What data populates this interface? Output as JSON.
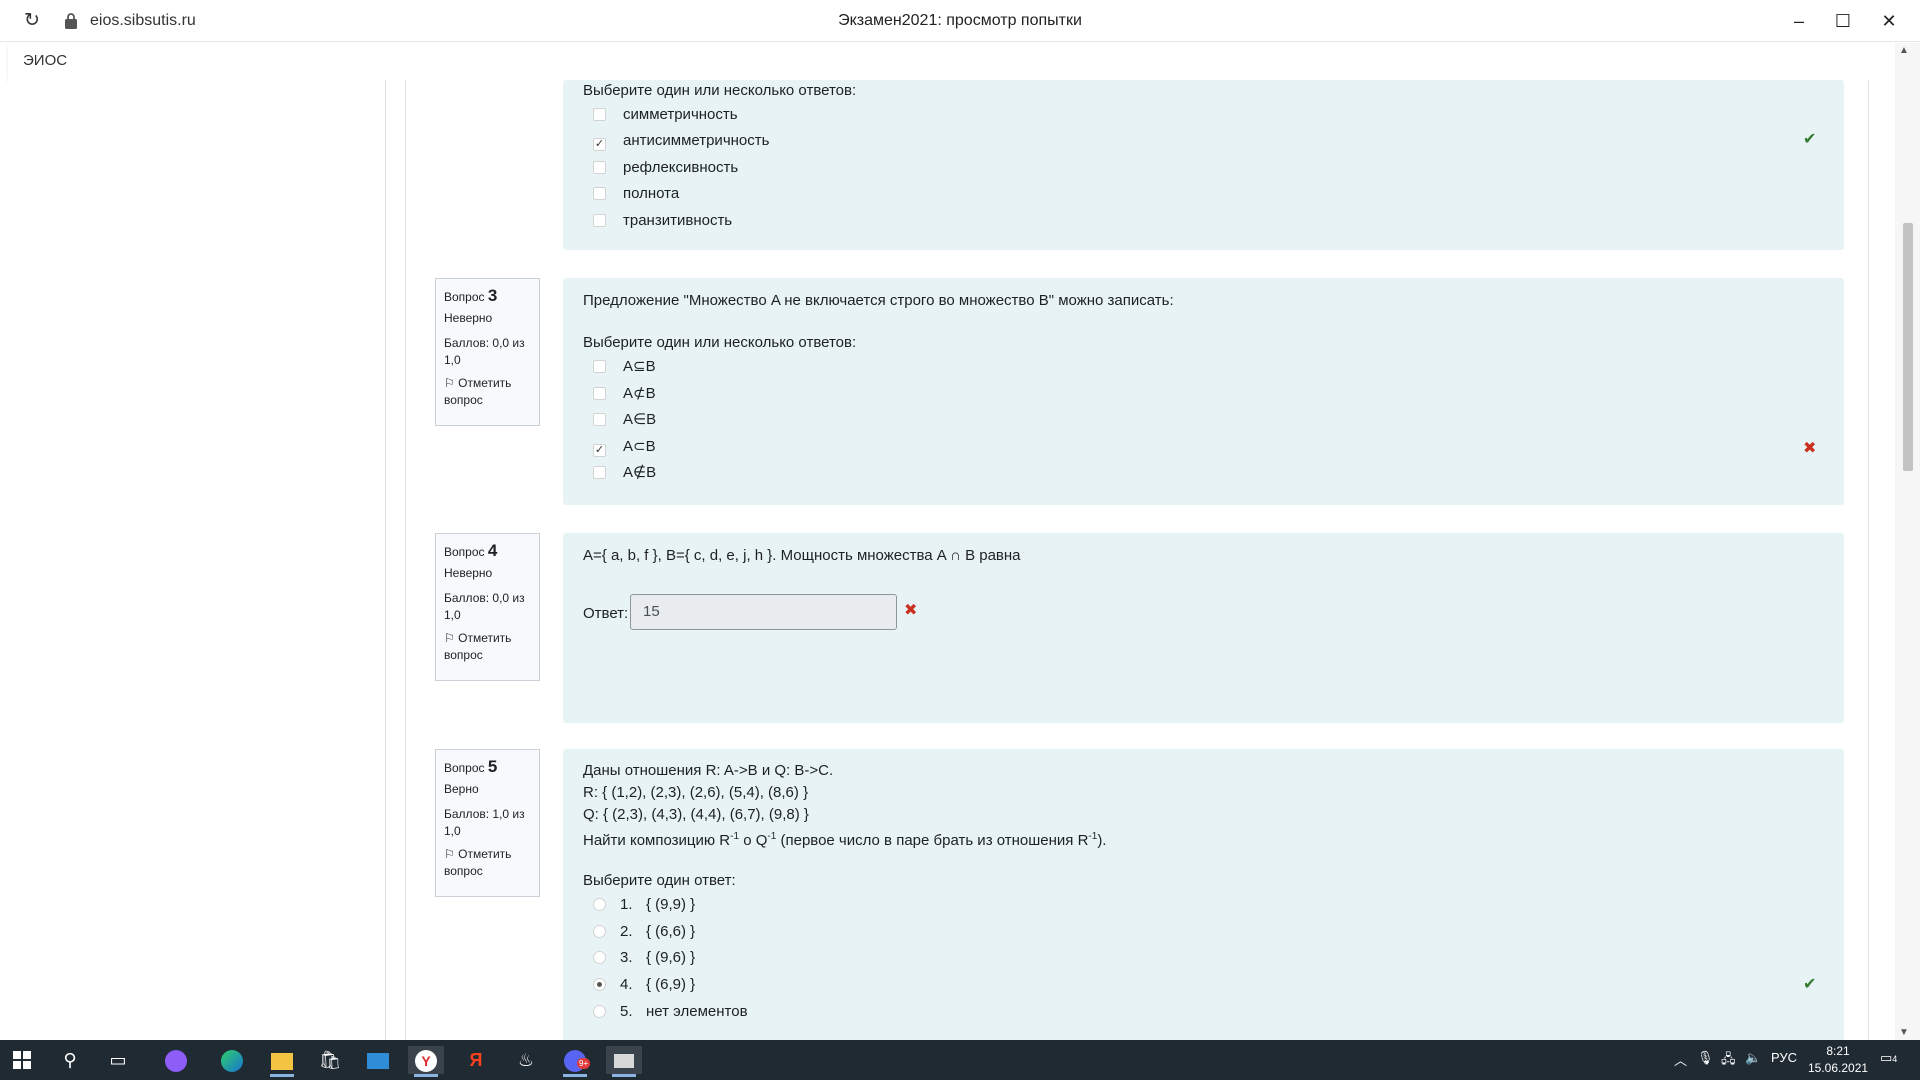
{
  "browser": {
    "url": "eios.sibsutis.ru",
    "title": "Экзамен2021: просмотр попытки",
    "minimize": "–",
    "maximize": "☐",
    "close": "✕"
  },
  "site": {
    "brand": "ЭИОС"
  },
  "question2": {
    "prompt": "Выберите один или несколько ответов:",
    "options": [
      {
        "label": "симметричность",
        "checked": false
      },
      {
        "label": "антисимметричность",
        "checked": true
      },
      {
        "label": "рефлексивность",
        "checked": false
      },
      {
        "label": "полнота",
        "checked": false
      },
      {
        "label": "транзитивность",
        "checked": false
      }
    ],
    "result": "correct"
  },
  "question3": {
    "info": {
      "prefix": "Вопрос",
      "number": "3",
      "state": "Неверно",
      "grade": "Баллов: 0,0 из 1,0",
      "flag": "Отметить вопрос"
    },
    "text": "Предложение \"Множество A не включается строго во множество B\" можно записать:",
    "prompt": "Выберите один или несколько ответов:",
    "options": [
      {
        "label": "A⊆B",
        "checked": false
      },
      {
        "label": "A⊄B",
        "checked": false
      },
      {
        "label": "A∈B",
        "checked": false
      },
      {
        "label": "A⊂B",
        "checked": true
      },
      {
        "label": "A∉B",
        "checked": false
      }
    ],
    "result": "incorrect"
  },
  "question4": {
    "info": {
      "prefix": "Вопрос",
      "number": "4",
      "state": "Неверно",
      "grade": "Баллов: 0,0 из 1,0",
      "flag": "Отметить вопрос"
    },
    "text": "A={ a, b, f }, B={ c, d, e, j, h }. Мощность множества A ∩ B равна",
    "answer_label": "Ответ:",
    "answer_value": "15",
    "result": "incorrect"
  },
  "question5": {
    "info": {
      "prefix": "Вопрос",
      "number": "5",
      "state": "Верно",
      "grade": "Баллов: 1,0 из 1,0",
      "flag": "Отметить вопрос"
    },
    "line1": "Даны отношения R: A->B  и  Q: B->C.",
    "line2": "R: { (1,2), (2,3), (2,6), (5,4), (8,6) }",
    "line3": "Q: { (2,3), (4,3), (4,4), (6,7), (9,8) }",
    "line4a": "Найти композицию R",
    "sup1": "-1",
    "line4b": " o Q",
    "sup2": "-1",
    "line4c": " (первое число в паре брать из отношения R",
    "sup3": "-1",
    "line4d": ").",
    "prompt": "Выберите один ответ:",
    "options": [
      {
        "num": "1.",
        "label": "{ (9,9) }",
        "checked": false
      },
      {
        "num": "2.",
        "label": "{ (6,6) }",
        "checked": false
      },
      {
        "num": "3.",
        "label": "{ (9,6) }",
        "checked": false
      },
      {
        "num": "4.",
        "label": "{ (6,9) }",
        "checked": true
      },
      {
        "num": "5.",
        "label": "нет элементов",
        "checked": false
      }
    ],
    "result": "correct"
  },
  "marks": {
    "check": "✔",
    "cross": "✖"
  },
  "taskbar": {
    "lang": "РУС",
    "time": "8:21",
    "date": "15.06.2021",
    "notif_count": "4",
    "mail_badge": "9+"
  }
}
